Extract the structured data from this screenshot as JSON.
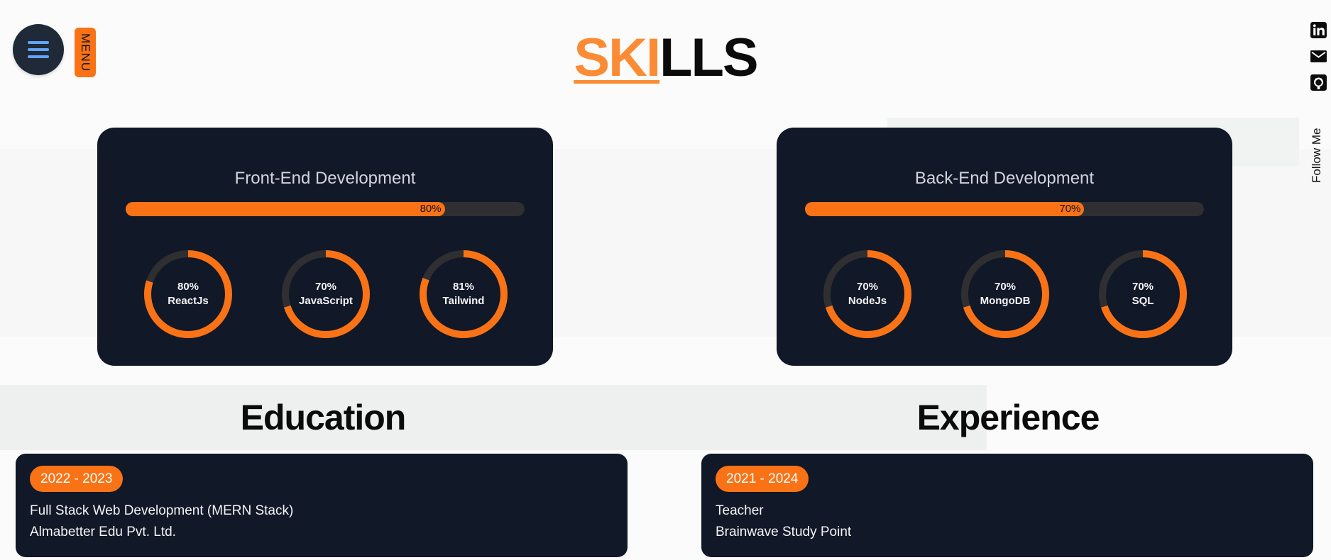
{
  "header": {
    "menu_label": "MENU",
    "title_accent": "SKI",
    "title_rest": "LLS",
    "follow_label": "Follow Me",
    "social": [
      {
        "icon": "linkedin-icon"
      },
      {
        "icon": "mail-icon"
      },
      {
        "icon": "github-icon"
      }
    ]
  },
  "skills": {
    "frontend": {
      "title": "Front-End Development",
      "progress": 80,
      "progress_label": "80%",
      "rings": [
        {
          "pct": 80,
          "pct_label": "80%",
          "name": "ReactJs"
        },
        {
          "pct": 70,
          "pct_label": "70%",
          "name": "JavaScript"
        },
        {
          "pct": 81,
          "pct_label": "81%",
          "name": "Tailwind"
        }
      ]
    },
    "backend": {
      "title": "Back-End Development",
      "progress": 70,
      "progress_label": "70%",
      "rings": [
        {
          "pct": 70,
          "pct_label": "70%",
          "name": "NodeJs"
        },
        {
          "pct": 70,
          "pct_label": "70%",
          "name": "MongoDB"
        },
        {
          "pct": 70,
          "pct_label": "70%",
          "name": "SQL"
        }
      ]
    }
  },
  "education": {
    "heading": "Education",
    "years": "2022 - 2023",
    "line1": "Full Stack Web Development (MERN Stack)",
    "line2": "Almabetter Edu Pvt. Ltd."
  },
  "experience": {
    "heading": "Experience",
    "years": "2021 - 2024",
    "line1": "Teacher",
    "line2": "Brainwave Study Point"
  },
  "colors": {
    "accent": "#f97316",
    "title_accent": "#fb8c35",
    "card_bg": "#111827",
    "track": "#2f2f31"
  }
}
